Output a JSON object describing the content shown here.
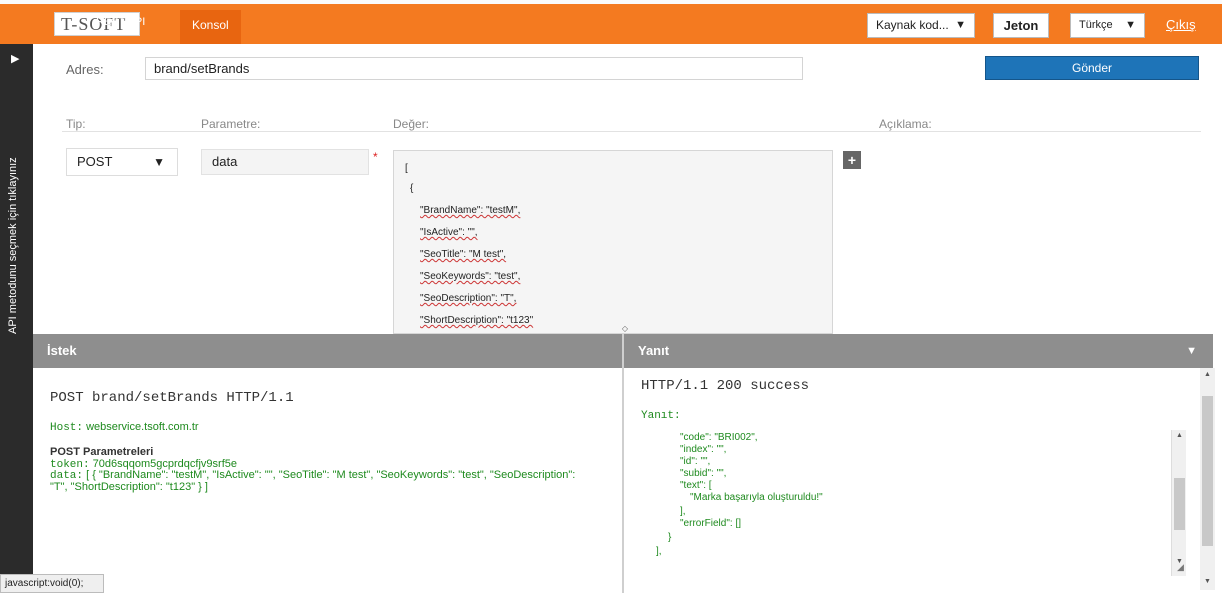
{
  "header": {
    "logo_text": "T-SOFT",
    "rest_label": "REST API",
    "konsol_label": "Konsol",
    "source_select": "Kaynak kod...",
    "jeton_label": "Jeton",
    "lang_select": "Türkçe",
    "logout_label": "Çıkış"
  },
  "sidebar": {
    "vertical_text": "API metodunu seçmek için tıklayınız"
  },
  "address": {
    "label": "Adres:",
    "value": "brand/setBrands",
    "send_label": "Gönder"
  },
  "params": {
    "headers": {
      "tip": "Tip:",
      "parametre": "Parametre:",
      "deger": "Değer:",
      "aciklama": "Açıklama:"
    },
    "method": "POST",
    "param_name": "data",
    "required_mark": "*",
    "value_lines": [
      "[",
      "{",
      "\"BrandName\": \"testM\",",
      "\"IsActive\": \"\",",
      "\"SeoTitle\": \"M test\",",
      "\"SeoKeywords\": \"test\",",
      "\"SeoDescription\": \"T\",",
      "\"ShortDescription\": \"t123\""
    ],
    "add_label": "+"
  },
  "request": {
    "bar_title": "İstek",
    "line": "POST brand/setBrands HTTP/1.1",
    "host_label": "Host:",
    "host_value": "webservice.tsoft.com.tr",
    "params_title": "POST Parametreleri",
    "token_label": "token:",
    "token_value": "70d6sqqom5gcprdqcfjv9srf5e",
    "data_label": "data:",
    "data_value": "[ { \"BrandName\": \"testM\", \"IsActive\": \"\", \"SeoTitle\": \"M test\", \"SeoKeywords\": \"test\", \"SeoDescription\": \"T\", \"ShortDescription\": \"t123\" } ]"
  },
  "response": {
    "bar_title": "Yanıt",
    "status_line": "HTTP/1.1 200 success",
    "label": "Yanıt:",
    "lines": [
      "\"code\": \"BRI002\",",
      "\"index\": \"\",",
      "\"id\": \"\",",
      "\"subid\": \"\",",
      "\"text\": [",
      "\"Marka başarıyla oluşturuldu!\"",
      "],",
      "\"errorField\": []",
      "}",
      "],"
    ]
  },
  "statusbar": {
    "text": "javascript:void(0);"
  },
  "colors": {
    "brand_orange": "#f47a20",
    "send_blue": "#1e74b8",
    "panel_gray": "#8e8e8e",
    "code_green": "#1e8a1e"
  },
  "icons": [
    "play-icon",
    "caret-down-icon",
    "plus-icon",
    "resize-icon",
    "scroll-up-icon",
    "scroll-down-icon"
  ]
}
